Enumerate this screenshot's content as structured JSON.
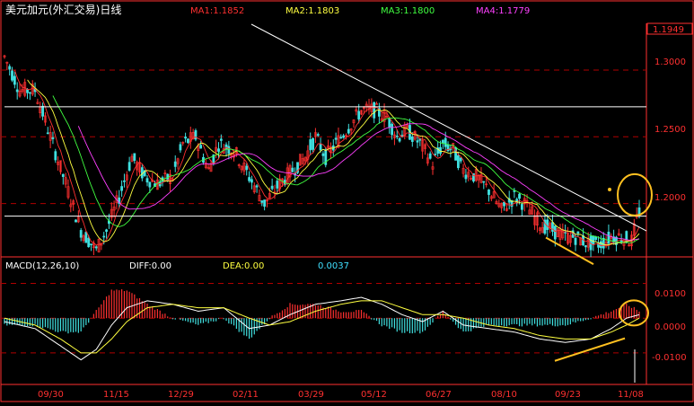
{
  "header": {
    "title": "美元加元(外汇交易)日线",
    "ma": [
      {
        "label": "MA1:1.1852",
        "color": "#ff3030"
      },
      {
        "label": "MA2:1.1803",
        "color": "#ffff40"
      },
      {
        "label": "MA3:1.1800",
        "color": "#40ff40"
      },
      {
        "label": "MA4:1.1779",
        "color": "#ff40ff"
      }
    ]
  },
  "price_axis": {
    "current_label": "1.1949",
    "ticks": [
      {
        "label": "1.3000",
        "value": 1.3
      },
      {
        "label": "1.2500",
        "value": 1.25
      },
      {
        "label": "1.2000",
        "value": 1.2
      }
    ]
  },
  "macd_header": {
    "name": "MACD(12,26,10)",
    "diff": "DIFF:0.00",
    "dea": "DEA:0.00",
    "macd": "0.0037"
  },
  "macd_axis": {
    "ticks": [
      {
        "label": "0.0100",
        "value": 0.01
      },
      {
        "label": "0.0000",
        "value": 0.0
      },
      {
        "label": "-0.0100",
        "value": -0.01
      }
    ]
  },
  "x_axis": {
    "ticks": [
      "09/30",
      "11/15",
      "12/29",
      "02/11",
      "03/29",
      "05/12",
      "06/27",
      "08/10",
      "09/23",
      "11/08"
    ]
  },
  "colors": {
    "up": "#ff3030",
    "down": "#40e0e0",
    "grid": "#b00000",
    "axis_text": "#ff3030",
    "annotation": "#ffc020",
    "trendline": "#ffffff"
  },
  "chart_data": {
    "type": "candlestick",
    "title": "美元加元(外汇交易)日线",
    "moving_averages": {
      "MA1": 1.1852,
      "MA2": 1.1803,
      "MA3": 1.18,
      "MA4": 1.1779
    },
    "last_price": 1.1949,
    "price_ylim": [
      1.16,
      1.335
    ],
    "price_path": [
      [
        0,
        1.31
      ],
      [
        6,
        1.285
      ],
      [
        12,
        1.285
      ],
      [
        18,
        1.25
      ],
      [
        24,
        1.215
      ],
      [
        30,
        1.18
      ],
      [
        36,
        1.165
      ],
      [
        40,
        1.18
      ],
      [
        45,
        1.205
      ],
      [
        50,
        1.235
      ],
      [
        55,
        1.22
      ],
      [
        60,
        1.215
      ],
      [
        66,
        1.22
      ],
      [
        70,
        1.245
      ],
      [
        75,
        1.25
      ],
      [
        80,
        1.225
      ],
      [
        84,
        1.245
      ],
      [
        90,
        1.24
      ],
      [
        96,
        1.22
      ],
      [
        102,
        1.2
      ],
      [
        108,
        1.215
      ],
      [
        113,
        1.225
      ],
      [
        118,
        1.235
      ],
      [
        122,
        1.25
      ],
      [
        126,
        1.235
      ],
      [
        130,
        1.245
      ],
      [
        134,
        1.255
      ],
      [
        140,
        1.27
      ],
      [
        145,
        1.27
      ],
      [
        150,
        1.265
      ],
      [
        154,
        1.25
      ],
      [
        158,
        1.255
      ],
      [
        163,
        1.245
      ],
      [
        168,
        1.23
      ],
      [
        172,
        1.245
      ],
      [
        176,
        1.24
      ],
      [
        180,
        1.225
      ],
      [
        185,
        1.22
      ],
      [
        190,
        1.21
      ],
      [
        195,
        1.195
      ],
      [
        200,
        1.205
      ],
      [
        204,
        1.2
      ],
      [
        210,
        1.185
      ],
      [
        215,
        1.18
      ],
      [
        220,
        1.175
      ],
      [
        224,
        1.175
      ],
      [
        229,
        1.17
      ],
      [
        234,
        1.17
      ],
      [
        238,
        1.175
      ],
      [
        242,
        1.175
      ],
      [
        246,
        1.172
      ],
      [
        249,
        1.195
      ]
    ],
    "macd_ylim": [
      -0.0165,
      0.0135
    ],
    "diff_path": [
      [
        0,
        -0.001
      ],
      [
        12,
        -0.003
      ],
      [
        22,
        -0.008
      ],
      [
        30,
        -0.012
      ],
      [
        36,
        -0.009
      ],
      [
        42,
        -0.002
      ],
      [
        48,
        0.003
      ],
      [
        56,
        0.005
      ],
      [
        66,
        0.004
      ],
      [
        76,
        0.002
      ],
      [
        86,
        0.003
      ],
      [
        96,
        -0.003
      ],
      [
        104,
        -0.002
      ],
      [
        112,
        0.001
      ],
      [
        122,
        0.004
      ],
      [
        132,
        0.005
      ],
      [
        140,
        0.006
      ],
      [
        148,
        0.004
      ],
      [
        156,
        0.001
      ],
      [
        164,
        -0.001
      ],
      [
        172,
        0.002
      ],
      [
        180,
        -0.002
      ],
      [
        190,
        -0.003
      ],
      [
        200,
        -0.004
      ],
      [
        210,
        -0.006
      ],
      [
        220,
        -0.007
      ],
      [
        230,
        -0.006
      ],
      [
        238,
        -0.003
      ],
      [
        244,
        0.0
      ],
      [
        249,
        0.001
      ]
    ],
    "dea_path": [
      [
        0,
        0.0
      ],
      [
        12,
        -0.002
      ],
      [
        22,
        -0.006
      ],
      [
        30,
        -0.01
      ],
      [
        36,
        -0.01
      ],
      [
        42,
        -0.006
      ],
      [
        48,
        -0.001
      ],
      [
        56,
        0.003
      ],
      [
        66,
        0.004
      ],
      [
        76,
        0.003
      ],
      [
        86,
        0.003
      ],
      [
        96,
        0.0
      ],
      [
        104,
        -0.002
      ],
      [
        112,
        -0.001
      ],
      [
        122,
        0.002
      ],
      [
        132,
        0.004
      ],
      [
        140,
        0.005
      ],
      [
        148,
        0.005
      ],
      [
        156,
        0.003
      ],
      [
        164,
        0.001
      ],
      [
        172,
        0.001
      ],
      [
        180,
        0.0
      ],
      [
        190,
        -0.002
      ],
      [
        200,
        -0.003
      ],
      [
        210,
        -0.005
      ],
      [
        220,
        -0.006
      ],
      [
        230,
        -0.006
      ],
      [
        238,
        -0.004
      ],
      [
        244,
        -0.002
      ],
      [
        249,
        0.0
      ]
    ],
    "annotations": [
      "descending trendline from upper left",
      "horizontal resistance and support lines",
      "circled breakout in price and MACD"
    ]
  }
}
